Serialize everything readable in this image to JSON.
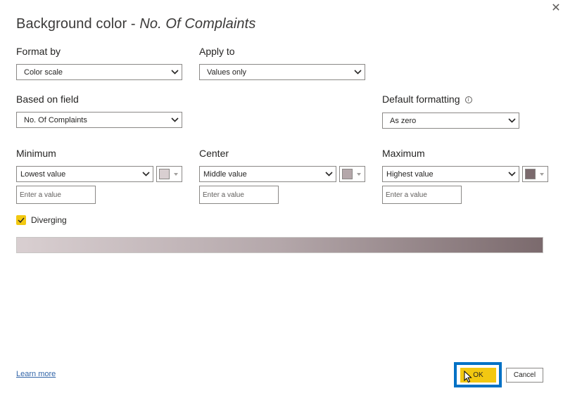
{
  "dialog": {
    "title_prefix": "Background color - ",
    "title_field": "No. Of Complaints",
    "close_icon": "close-icon"
  },
  "format_by": {
    "label": "Format by",
    "value": "Color scale"
  },
  "apply_to": {
    "label": "Apply to",
    "value": "Values only"
  },
  "based_on_field": {
    "label": "Based on field",
    "value": "No. Of Complaints"
  },
  "default_formatting": {
    "label": "Default formatting",
    "value": "As zero",
    "info_icon": "info-icon"
  },
  "minimum": {
    "label": "Minimum",
    "type_value": "Lowest value",
    "color": "#d9cfd1",
    "placeholder": "Enter a value"
  },
  "center": {
    "label": "Center",
    "type_value": "Middle value",
    "color": "#b4a7aa",
    "placeholder": "Enter a value"
  },
  "maximum": {
    "label": "Maximum",
    "type_value": "Highest value",
    "color": "#7b6a6d",
    "placeholder": "Enter a value"
  },
  "diverging": {
    "label": "Diverging",
    "checked": true
  },
  "gradient": {
    "start": "#d9cfd1",
    "middle": "#b4a7aa",
    "end": "#7b6a6d"
  },
  "footer": {
    "learn_more": "Learn more",
    "ok_label": "OK",
    "cancel_label": "Cancel",
    "accent": "#f2c811",
    "highlight": "#0071c5"
  }
}
